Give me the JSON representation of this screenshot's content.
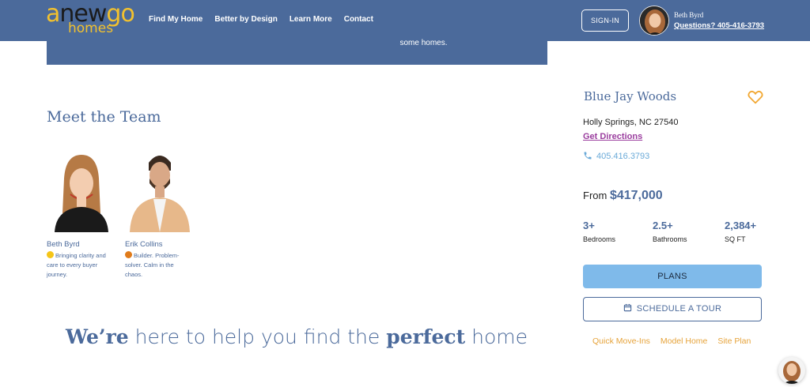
{
  "header": {
    "logo": {
      "line1_a": "a",
      "line1_b": "new",
      "line1_c": "go",
      "line2": "homes"
    },
    "nav": [
      "Find My Home",
      "Better by Design",
      "Learn More",
      "Contact"
    ],
    "signin_label": "SIGN-IN",
    "agent_name": "Beth Byrd",
    "agent_phone": "Questions? 405-416-3793"
  },
  "banner": {
    "text": "some homes."
  },
  "team": {
    "title": "Meet the Team",
    "members": [
      {
        "name": "Beth Byrd",
        "bio": "Bringing clarity and care to every buyer journey.",
        "emoji_color": "#f5c518"
      },
      {
        "name": "Erik Collins",
        "bio": "Builder. Problem-solver. Calm in the chaos.",
        "emoji_color": "#e07b1a"
      }
    ]
  },
  "tagline": {
    "a": "We’re",
    "b": " here to help you find the ",
    "c": "perfect",
    "d": " home"
  },
  "community": {
    "name": "Blue Jay Woods",
    "address": "Holly Springs, NC 27540",
    "directions_label": "Get Directions",
    "phone": "405.416.3793",
    "price_prefix": "From ",
    "price": "$417,000",
    "stats": [
      {
        "value": "3+",
        "label": "Bedrooms"
      },
      {
        "value": "2.5+",
        "label": "Bathrooms"
      },
      {
        "value": "2,384+",
        "label": "SQ FT"
      }
    ],
    "plans_label": "PLANS",
    "tour_label": "SCHEDULE A TOUR",
    "links": [
      "Quick Move-Ins",
      "Model Home",
      "Site Plan"
    ]
  },
  "colors": {
    "brand": "#4b6a9b",
    "accent": "#f2c12e",
    "plans_button": "#7fbaea",
    "link_orange": "#e6a33a",
    "directions": "#9a3d9e"
  },
  "icons": [
    "heart-icon",
    "phone-icon",
    "calendar-icon"
  ]
}
